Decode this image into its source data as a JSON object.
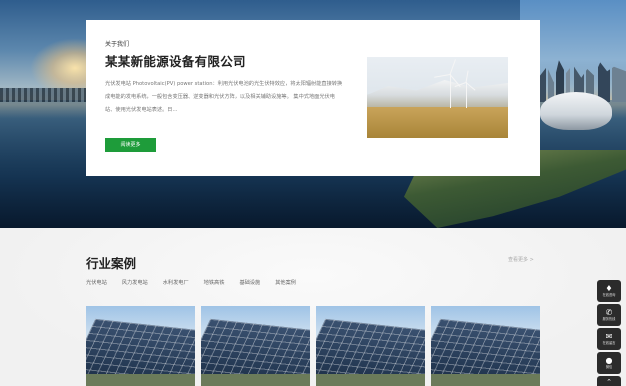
{
  "about": {
    "eyebrow": "关于我们",
    "company_name": "某某新能源设备有限公司",
    "description": "光伏发电站 Photovoltaic(PV) power station：利用光伏电池的光生伏特效应，将太阳辐射能直接转换成电能的发电系统，一般包含变压器、逆变器和光伏方阵，以及相关辅助设施等。 集中式地面光伏电站、使用光伏发电站表述。日...",
    "more_label": "阅读更多",
    "accent_color": "#1e9c3a"
  },
  "cases": {
    "title": "行业案例",
    "view_more": "查看更多 >",
    "tabs": [
      "光伏电站",
      "风力发电站",
      "水利发电厂",
      "地铁高铁",
      "基础设施",
      "其他案例"
    ]
  },
  "sidebar": {
    "items": [
      {
        "icon": "bell-icon",
        "label": "在线咨询"
      },
      {
        "icon": "phone-icon",
        "label": "服务热线"
      },
      {
        "icon": "chat-icon",
        "label": "在线留言"
      },
      {
        "icon": "wechat-icon",
        "label": "微信"
      }
    ],
    "top_icon": "arrow-up-icon"
  }
}
